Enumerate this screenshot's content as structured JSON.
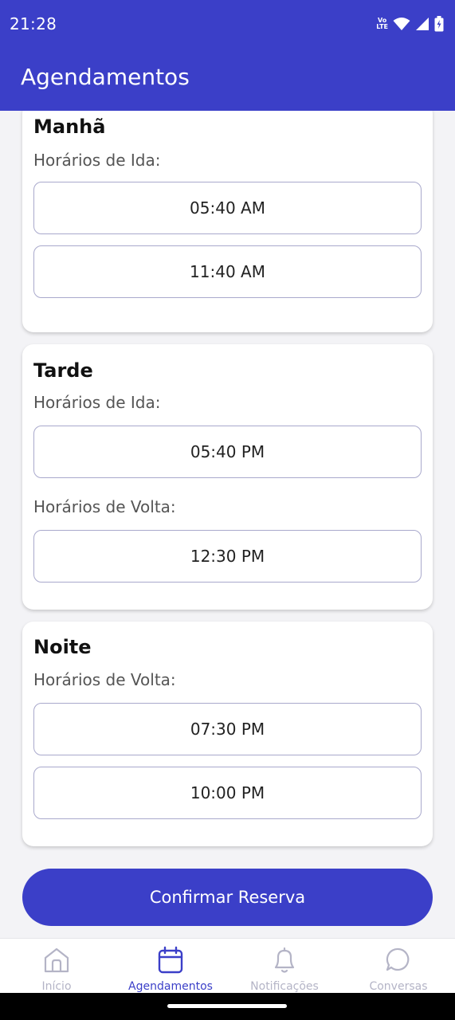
{
  "status": {
    "time": "21:28",
    "volte_top": "Vo",
    "volte_bottom": "LTE",
    "icons": [
      "volte-icon",
      "wifi-icon",
      "signal-icon",
      "battery-icon"
    ]
  },
  "header": {
    "title": "Agendamentos"
  },
  "sections": [
    {
      "title": "Manhã",
      "groups": [
        {
          "label": "Horários de Ida:",
          "times": [
            "05:40 AM",
            "11:40 AM"
          ]
        }
      ]
    },
    {
      "title": "Tarde",
      "groups": [
        {
          "label": "Horários de Ida:",
          "times": [
            "05:40 PM"
          ]
        },
        {
          "label": "Horários de Volta:",
          "times": [
            "12:30 PM"
          ]
        }
      ]
    },
    {
      "title": "Noite",
      "groups": [
        {
          "label": "Horários de Volta:",
          "times": [
            "07:30 PM",
            "10:00 PM"
          ]
        }
      ]
    }
  ],
  "confirm_label": "Confirmar Reserva",
  "nav": {
    "items": [
      {
        "label": "Início",
        "icon": "home-icon"
      },
      {
        "label": "Agendamentos",
        "icon": "calendar-icon",
        "active": true
      },
      {
        "label": "Notificações",
        "icon": "bell-icon"
      },
      {
        "label": "Conversas",
        "icon": "chat-icon"
      }
    ]
  },
  "colors": {
    "primary": "#3b3fc8",
    "inactive_nav": "#b4b4c6",
    "background": "#f3f3f6"
  }
}
